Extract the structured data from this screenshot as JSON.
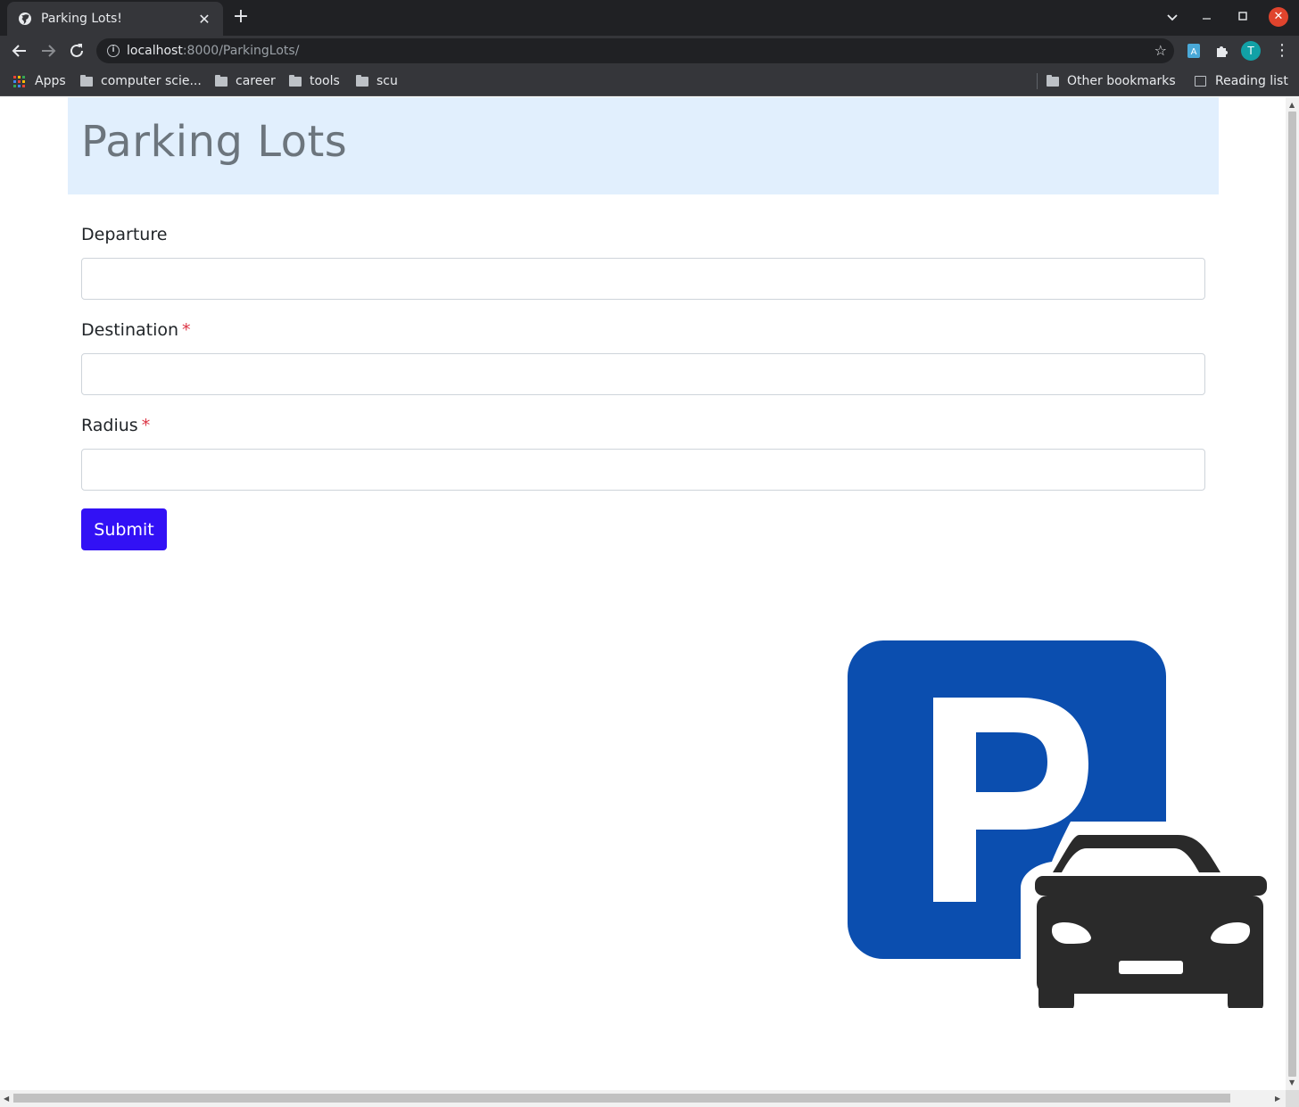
{
  "browser": {
    "tab_title": "Parking Lots!",
    "tab_close": "✕",
    "new_tab": "+",
    "url_host": "localhost",
    "url_rest": ":8000/ParkingLots/",
    "avatar_letter": "T",
    "bookmarks": [
      {
        "label": "Apps",
        "icon": "apps-icon"
      },
      {
        "label": "computer scie...",
        "icon": "folder-icon"
      },
      {
        "label": "career",
        "icon": "folder-icon"
      },
      {
        "label": "tools",
        "icon": "folder-icon"
      },
      {
        "label": "scu",
        "icon": "folder-icon"
      }
    ],
    "other_bookmarks": "Other bookmarks",
    "reading_list": "Reading list"
  },
  "page": {
    "title": "Parking Lots",
    "form": {
      "departure_label": "Departure",
      "departure_value": "",
      "destination_label": "Destination",
      "destination_value": "",
      "radius_label": "Radius",
      "radius_value": "",
      "required_marker": "*",
      "submit_label": "Submit"
    },
    "logo": {
      "icon": "parking-car-icon",
      "letter": "P",
      "sign_color": "#0b4eaf",
      "car_color": "#2a2a2a"
    }
  },
  "colors": {
    "header_bg": "#e1effd",
    "title_color": "#6c757d",
    "submit_bg": "#3211f5",
    "required": "#dc3545"
  }
}
